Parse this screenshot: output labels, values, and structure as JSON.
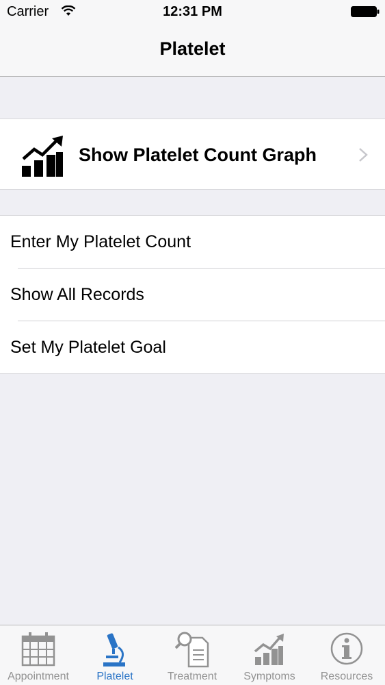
{
  "status_bar": {
    "carrier": "Carrier",
    "time": "12:31 PM"
  },
  "nav": {
    "title": "Platelet"
  },
  "graph_row": {
    "label": "Show Platelet Count Graph",
    "icon": "bar-chart-trend-icon"
  },
  "menu": {
    "items": [
      {
        "label": "Enter My Platelet Count"
      },
      {
        "label": "Show All Records"
      },
      {
        "label": "Set My Platelet Goal"
      }
    ]
  },
  "tab_bar": {
    "active_color": "#2a74c6",
    "inactive_color": "#929292",
    "tabs": [
      {
        "label": "Appointment",
        "icon": "calendar-icon",
        "active": false
      },
      {
        "label": "Platelet",
        "icon": "microscope-icon",
        "active": true
      },
      {
        "label": "Treatment",
        "icon": "document-search-icon",
        "active": false
      },
      {
        "label": "Symptoms",
        "icon": "chart-trend-icon",
        "active": false
      },
      {
        "label": "Resources",
        "icon": "info-icon",
        "active": false
      }
    ]
  }
}
